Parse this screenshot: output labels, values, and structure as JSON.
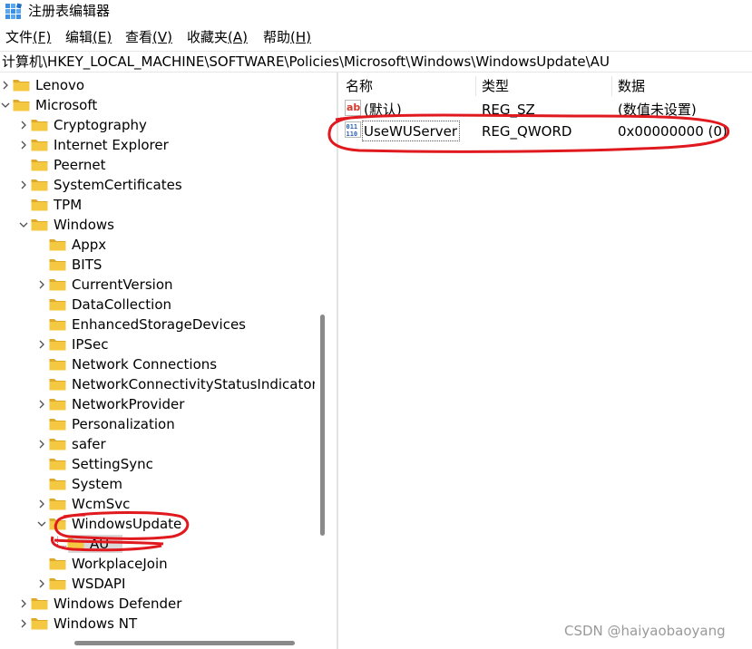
{
  "window": {
    "title": "注册表编辑器"
  },
  "menu": [
    {
      "label": "文件",
      "accel": "(F)"
    },
    {
      "label": "编辑",
      "accel": "(E)"
    },
    {
      "label": "查看",
      "accel": "(V)"
    },
    {
      "label": "收藏夹",
      "accel": "(A)"
    },
    {
      "label": "帮助",
      "accel": "(H)"
    }
  ],
  "address": "计算机\\HKEY_LOCAL_MACHINE\\SOFTWARE\\Policies\\Microsoft\\Windows\\WindowsUpdate\\AU",
  "tree": [
    {
      "label": "Lenovo",
      "expander": "right"
    },
    {
      "label": "Microsoft",
      "expander": "down"
    },
    {
      "label": "Cryptography",
      "expander": "right"
    },
    {
      "label": "Internet Explorer",
      "expander": "right"
    },
    {
      "label": "Peernet",
      "expander": "none"
    },
    {
      "label": "SystemCertificates",
      "expander": "right"
    },
    {
      "label": "TPM",
      "expander": "none"
    },
    {
      "label": "Windows",
      "expander": "down"
    },
    {
      "label": "Appx",
      "expander": "none"
    },
    {
      "label": "BITS",
      "expander": "none"
    },
    {
      "label": "CurrentVersion",
      "expander": "right"
    },
    {
      "label": "DataCollection",
      "expander": "none"
    },
    {
      "label": "EnhancedStorageDevices",
      "expander": "none"
    },
    {
      "label": "IPSec",
      "expander": "right"
    },
    {
      "label": "Network Connections",
      "expander": "none"
    },
    {
      "label": "NetworkConnectivityStatusIndicator",
      "expander": "none"
    },
    {
      "label": "NetworkProvider",
      "expander": "right"
    },
    {
      "label": "Personalization",
      "expander": "none"
    },
    {
      "label": "safer",
      "expander": "right"
    },
    {
      "label": "SettingSync",
      "expander": "none"
    },
    {
      "label": "System",
      "expander": "none"
    },
    {
      "label": "WcmSvc",
      "expander": "right"
    },
    {
      "label": "WindowsUpdate",
      "expander": "down"
    },
    {
      "label": "AU",
      "expander": "none",
      "selected": true
    },
    {
      "label": "WorkplaceJoin",
      "expander": "none"
    },
    {
      "label": "WSDAPI",
      "expander": "right"
    },
    {
      "label": "Windows Defender",
      "expander": "right"
    },
    {
      "label": "Windows NT",
      "expander": "right"
    }
  ],
  "list": {
    "columns": [
      "名称",
      "类型",
      "数据"
    ],
    "rows": [
      {
        "icon": "string-value-icon",
        "name": "(默认)",
        "type": "REG_SZ",
        "data": "(数值未设置)"
      },
      {
        "icon": "binary-value-icon",
        "name": "UseWUServer",
        "type": "REG_QWORD",
        "data": "0x00000000 (0)"
      }
    ]
  },
  "watermark": "CSDN @haiyaobaoyang",
  "colors": {
    "folder": "#f5c842",
    "folder_dark": "#dca92a",
    "annotation": "#e0191e",
    "selection": "#d9d9d9"
  }
}
